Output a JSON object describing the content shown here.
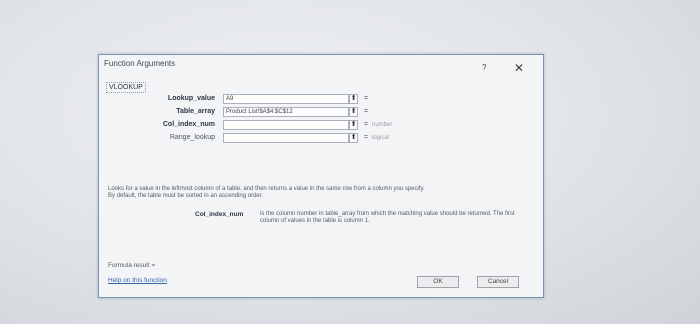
{
  "dialog": {
    "title": "Function Arguments",
    "help": "?",
    "close": "✕",
    "function_name": "VLOOKUP"
  },
  "args": [
    {
      "label": "Lookup_value",
      "value": "A9",
      "result": "",
      "bold": true
    },
    {
      "label": "Table_array",
      "value": "Product List!$A$4:$C$12",
      "result": "",
      "bold": true
    },
    {
      "label": "Col_index_num",
      "value": "",
      "result": "number",
      "bold": true
    },
    {
      "label": "Range_lookup",
      "value": "",
      "result": "logical",
      "bold": false
    }
  ],
  "equals": "=",
  "ref_icon": "⬆",
  "description": {
    "line1": "Looks for a value in the leftmost column of a table, and then returns a value in the same row from a column you specify.",
    "line2": "By default, the table must be sorted in an ascending order."
  },
  "arg_help": {
    "name": "Col_index_num",
    "text": "is the column number in table_array from which the matching value should be returned. The first column of values in the table is column 1."
  },
  "formula_result": "Formula result =",
  "help_link": "Help on this function",
  "buttons": {
    "ok": "OK",
    "cancel": "Cancel"
  }
}
